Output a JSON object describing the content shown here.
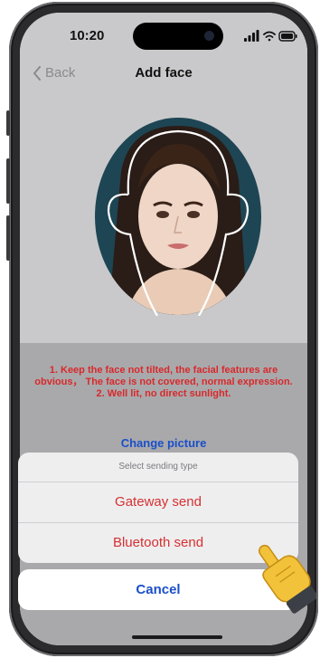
{
  "status_bar": {
    "time": "10:20",
    "icons": [
      "signal-icon",
      "wifi-icon",
      "battery-icon"
    ]
  },
  "nav": {
    "back_label": "Back",
    "title": "Add face",
    "back_icon": "chevron-left-icon"
  },
  "tips": [
    "1. Keep the face not tilted, the facial features are",
    "obvious， The face is not covered, normal expression.",
    "2. Well lit, no direct sunlight."
  ],
  "change_picture_label": "Change picture",
  "action_sheet": {
    "header": "Select sending type",
    "options": [
      "Gateway send",
      "Bluetooth send"
    ],
    "cancel_label": "Cancel"
  },
  "colors": {
    "danger_red": "#d63031",
    "link_blue": "#1b4fc9",
    "guide_outline": "#ffffff",
    "portrait_bg": "#1e4553"
  }
}
